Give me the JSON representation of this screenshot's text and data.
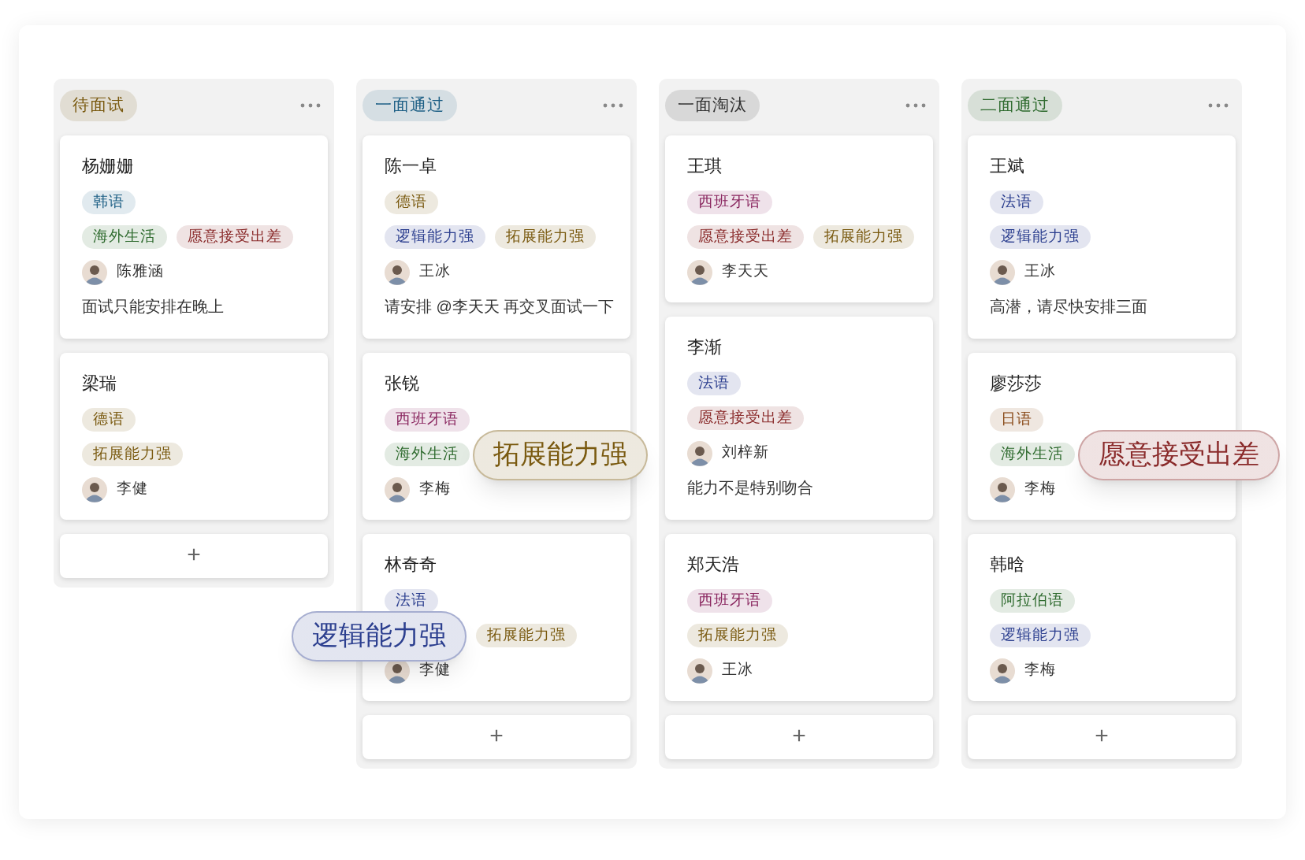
{
  "columns": [
    {
      "title": "待面试",
      "color": "#7a5a10",
      "cards": [
        {
          "name": "杨姗姗",
          "tag_rows": [
            [
              {
                "text": "韩语",
                "color": "#1d5f85"
              }
            ],
            [
              {
                "text": "海外生活",
                "color": "#2f6b2f"
              },
              {
                "text": "愿意接受出差",
                "color": "#8a2b2b"
              }
            ]
          ],
          "assignee": "陈雅涵",
          "note": "面试只能安排在晚上"
        },
        {
          "name": "梁瑞",
          "tag_rows": [
            [
              {
                "text": "德语",
                "color": "#7a5a10"
              }
            ],
            [
              {
                "text": "拓展能力强",
                "color": "#7a5a10"
              }
            ]
          ],
          "assignee": "李健"
        }
      ],
      "add": "+"
    },
    {
      "title": "一面通过",
      "color": "#1d5f85",
      "cards": [
        {
          "name": "陈一卓",
          "tag_rows": [
            [
              {
                "text": "德语",
                "color": "#7a5a10"
              }
            ],
            [
              {
                "text": "逻辑能力强",
                "color": "#2c3f8f"
              },
              {
                "text": "拓展能力强",
                "color": "#7a5a10"
              }
            ]
          ],
          "assignee": "王冰",
          "note": "请安排 @李天天 再交叉面试一下"
        },
        {
          "name": "张锐",
          "tag_rows": [
            [
              {
                "text": "西班牙语",
                "color": "#8a2760"
              }
            ],
            [
              {
                "text": "海外生活",
                "color": "#2f6b2f"
              },
              {
                "text": "拓展能力强",
                "color": "#7a5a10",
                "kind": "floating"
              }
            ]
          ],
          "assignee": "李梅"
        },
        {
          "name": "林奇奇",
          "tag_rows": [
            [
              {
                "text": "法语",
                "color": "#2c3f8f"
              }
            ],
            [
              {
                "text": "逻辑能力强",
                "color": "#2c3f8f",
                "kind": "covering"
              },
              {
                "text": "拓展能力强",
                "color": "#7a5a10"
              }
            ]
          ],
          "assignee": "李健"
        }
      ],
      "add": "+"
    },
    {
      "title": "一面淘汰",
      "color": "#333333",
      "cards": [
        {
          "name": "王琪",
          "tag_rows": [
            [
              {
                "text": "西班牙语",
                "color": "#8a2760"
              }
            ],
            [
              {
                "text": "愿意接受出差",
                "color": "#8a2b2b"
              },
              {
                "text": "拓展能力强",
                "color": "#7a5a10"
              }
            ]
          ],
          "assignee": "李天天"
        },
        {
          "name": "李渐",
          "tag_rows": [
            [
              {
                "text": "法语",
                "color": "#2c3f8f"
              }
            ],
            [
              {
                "text": "愿意接受出差",
                "color": "#8a2b2b"
              }
            ]
          ],
          "assignee": "刘梓新",
          "note": "能力不是特别吻合"
        },
        {
          "name": "郑天浩",
          "tag_rows": [
            [
              {
                "text": "西班牙语",
                "color": "#8a2760"
              }
            ],
            [
              {
                "text": "拓展能力强",
                "color": "#7a5a10"
              }
            ]
          ],
          "assignee": "王冰"
        }
      ],
      "add": "+"
    },
    {
      "title": "二面通过",
      "color": "#2f6b2f",
      "cards": [
        {
          "name": "王斌",
          "tag_rows": [
            [
              {
                "text": "法语",
                "color": "#2c3f8f"
              }
            ],
            [
              {
                "text": "逻辑能力强",
                "color": "#2c3f8f"
              }
            ]
          ],
          "assignee": "王冰",
          "note": "高潜，请尽快安排三面"
        },
        {
          "name": "廖莎莎",
          "tag_rows": [
            [
              {
                "text": "日语",
                "color": "#8a4b1a"
              }
            ],
            [
              {
                "text": "海外生活",
                "color": "#2f6b2f"
              },
              {
                "text": "愿意接受出差",
                "color": "#8a2b2b",
                "kind": "floating"
              }
            ]
          ],
          "assignee": "李梅"
        },
        {
          "name": "韩晗",
          "tag_rows": [
            [
              {
                "text": "阿拉伯语",
                "color": "#2f6b2f"
              }
            ],
            [
              {
                "text": "逻辑能力强",
                "color": "#2c3f8f"
              }
            ]
          ],
          "assignee": "李梅"
        }
      ],
      "add": "+"
    }
  ]
}
